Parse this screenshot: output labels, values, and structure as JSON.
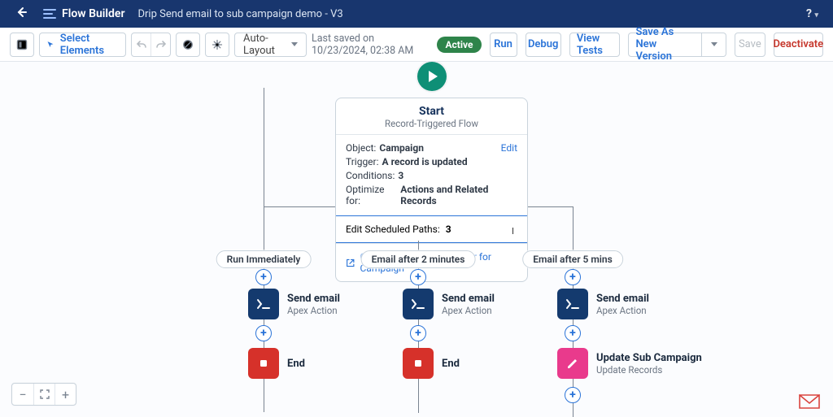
{
  "header": {
    "app": "Flow Builder",
    "title": "Drip Send email to sub campaign demo - V3",
    "help": "?"
  },
  "toolbar": {
    "select_elements": "Select Elements",
    "auto_layout": "Auto-Layout",
    "last_saved": "Last saved on 10/23/2024, 02:38 AM",
    "status": "Active",
    "run": "Run",
    "debug": "Debug",
    "view_tests": "View Tests",
    "save_as": "Save As New Version",
    "save": "Save",
    "deactivate": "Deactivate"
  },
  "start": {
    "title": "Start",
    "subtitle": "Record-Triggered Flow",
    "object_label": "Object:",
    "object_value": "Campaign",
    "trigger_label": "Trigger:",
    "trigger_value": "A record is updated",
    "conditions_label": "Conditions:",
    "conditions_value": "3",
    "optimize_label": "Optimize for:",
    "optimize_value": "Actions and Related Records",
    "edit": "Edit",
    "scheduled_label": "Scheduled Paths:",
    "scheduled_value": "3",
    "scheduled_edit": "Edit",
    "explorer": "Open Flow Trigger Explorer for Campaign"
  },
  "paths": {
    "p1": "Run Immediately",
    "p2": "Email after 2 minutes",
    "p3": "Email after 5 mins"
  },
  "nodes": {
    "send_email_title": "Send email",
    "send_email_sub": "Apex Action",
    "end": "End",
    "update_title": "Update Sub Campaign",
    "update_sub": "Update Records"
  }
}
